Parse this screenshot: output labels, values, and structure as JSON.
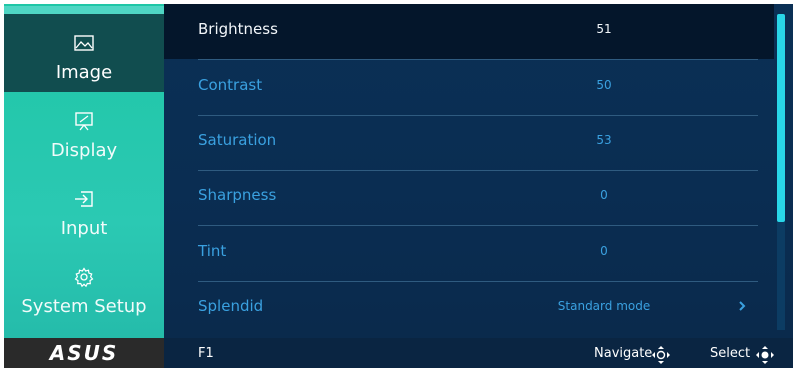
{
  "sidebar": {
    "items": [
      {
        "label": "Image",
        "icon": "image-icon"
      },
      {
        "label": "Display",
        "icon": "projector-icon"
      },
      {
        "label": "Input",
        "icon": "input-icon"
      },
      {
        "label": "System Setup",
        "icon": "gear-icon"
      }
    ],
    "active_index": 0,
    "logo_text": "ASUS"
  },
  "settings": [
    {
      "label": "Brightness",
      "value": "51"
    },
    {
      "label": "Contrast",
      "value": "50"
    },
    {
      "label": "Saturation",
      "value": "53"
    },
    {
      "label": "Sharpness",
      "value": "0"
    },
    {
      "label": "Tint",
      "value": "0"
    },
    {
      "label": "Splendid",
      "value": "Standard mode",
      "has_submenu": true
    }
  ],
  "footer": {
    "f1": "F1",
    "navigate": "Navigate",
    "select": "Select"
  },
  "colors": {
    "sidebar": "#2bc9b3",
    "active_item": "#114d4f",
    "panel": "#0a2d52",
    "selected_row": "#04162b",
    "item_text": "#3aa1e0",
    "scroll_thumb": "#29d6e8"
  }
}
